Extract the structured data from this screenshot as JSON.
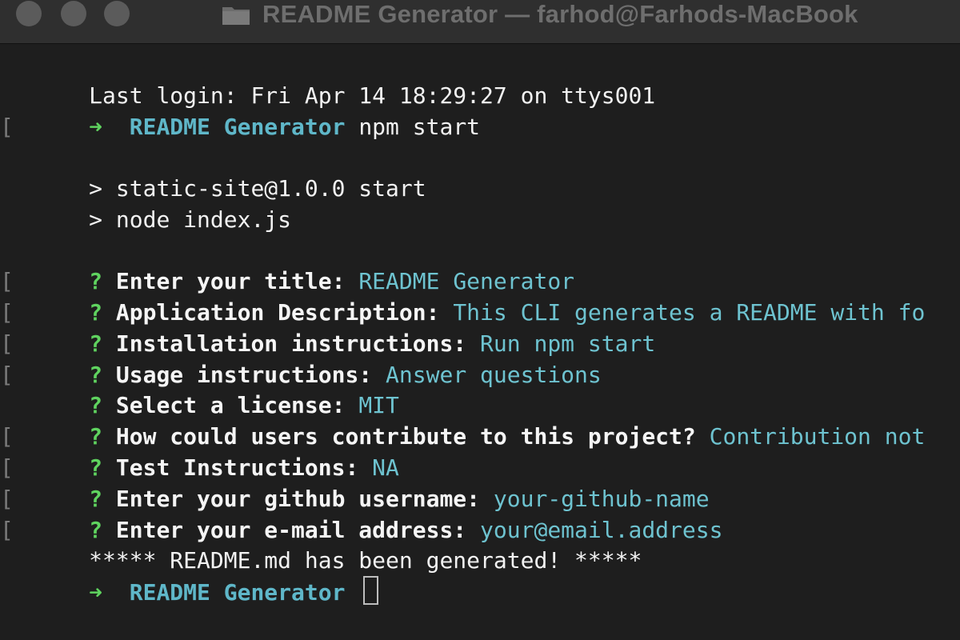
{
  "window": {
    "title": "README Generator — farhod@Farhods-MacBook"
  },
  "terminal": {
    "last_login": "Last login: Fri Apr 14 18:29:27 on ttys001",
    "prompt_bracket": "[",
    "prompt_arrow": "➜",
    "prompt_dir": "README Generator",
    "command": "npm start",
    "npm_lines": [
      "> static-site@1.0.0 start",
      "> node index.js"
    ],
    "question_marker": "?",
    "questions": [
      {
        "bracket": "[",
        "label": "Enter your title:",
        "answer": "README Generator"
      },
      {
        "bracket": "[",
        "label": "Application Description:",
        "answer": "This CLI generates a README with fo"
      },
      {
        "bracket": "[",
        "label": "Installation instructions:",
        "answer": "Run npm start"
      },
      {
        "bracket": "[",
        "label": "Usage instructions:",
        "answer": "Answer questions"
      },
      {
        "bracket": "",
        "label": "Select a license:",
        "answer": "MIT"
      },
      {
        "bracket": "[",
        "label": "How could users contribute to this project?",
        "answer": "Contribution not"
      },
      {
        "bracket": "[",
        "label": "Test Instructions:",
        "answer": "NA"
      },
      {
        "bracket": "[",
        "label": "Enter your github username:",
        "answer": "your-github-name"
      },
      {
        "bracket": "[",
        "label": "Enter your e-mail address:",
        "answer": "your@email.address"
      }
    ],
    "success_message": "***** README.md has been generated! *****",
    "final_prompt_arrow": "➜",
    "final_prompt_dir": "README Generator"
  },
  "colors": {
    "background": "#1e1e1e",
    "prompt_arrow": "#5fd35f",
    "directory": "#5fb7c9",
    "answer": "#6ec3d0",
    "text": "#f2f2f2"
  },
  "icons": {
    "window_controls": [
      "close-icon",
      "minimize-icon",
      "zoom-icon"
    ],
    "title_icon": "folder-icon"
  }
}
